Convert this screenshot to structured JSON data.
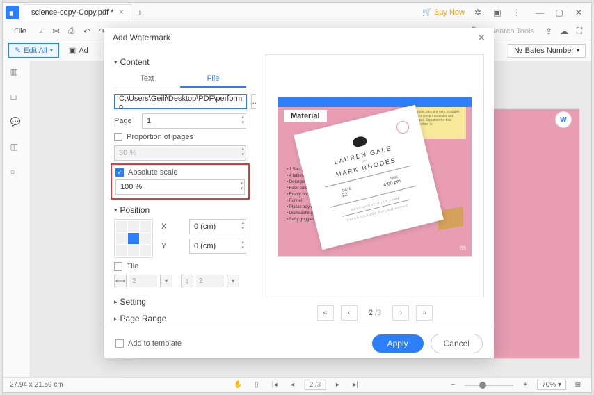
{
  "titlebar": {
    "filename": "science-copy-Copy.pdf *",
    "buy": "Buy Now"
  },
  "menubar": {
    "file": "File",
    "search": "Search Tools"
  },
  "ribbon": {
    "edit_all": "Edit All",
    "add": "Ad",
    "bates": "Bates Number"
  },
  "dialog": {
    "title": "Add Watermark",
    "content_h": "Content",
    "tab_text": "Text",
    "tab_file": "File",
    "path": "C:\\Users\\Geili\\Desktop\\PDF\\perform o",
    "page_lbl": "Page",
    "page_val": "1",
    "prop_lbl": "Proportion of pages",
    "prop_val": "30 %",
    "abs_lbl": "Absolute scale",
    "abs_val": "100 %",
    "position_h": "Position",
    "x_lbl": "X",
    "y_lbl": "Y",
    "x_val": "0 (cm)",
    "y_val": "0 (cm)",
    "tile_lbl": "Tile",
    "tile_v1": "2",
    "tile_v2": "2",
    "setting_h": "Setting",
    "range_h": "Page Range",
    "add_tpl": "Add to template",
    "pager_cur": "2",
    "pager_tot": "/3",
    "apply": "Apply",
    "cancel": "Cancel"
  },
  "preview": {
    "materials": "Material",
    "note": "Some molecules are very unstable and decompose into water and oxygen gas. Equation for this decomposition is:",
    "list": [
      "• 1 Sac",
      "• 4 tables",
      "• Detergent",
      "• Food color",
      "• Empty bottle",
      "• Funnel",
      "• Plastic tray or tub",
      "• Dishwashing gloves",
      "• Safty goggles"
    ],
    "page_num": "03",
    "card": {
      "name1": "LAUREN GALE",
      "and": "and",
      "name2": "MARK RHODES",
      "date_l": "DATE",
      "time_l": "TIME",
      "date_v": "22",
      "time_v": "4:00 pm",
      "venue": "GREENPOINT HILLS FARM",
      "url": "PAPERCULTURE.CO/LANDMARKS"
    }
  },
  "status": {
    "dims": "27.94 x 21.59 cm",
    "page_cur": "2",
    "page_tot": "/3",
    "zoom": "70%"
  }
}
